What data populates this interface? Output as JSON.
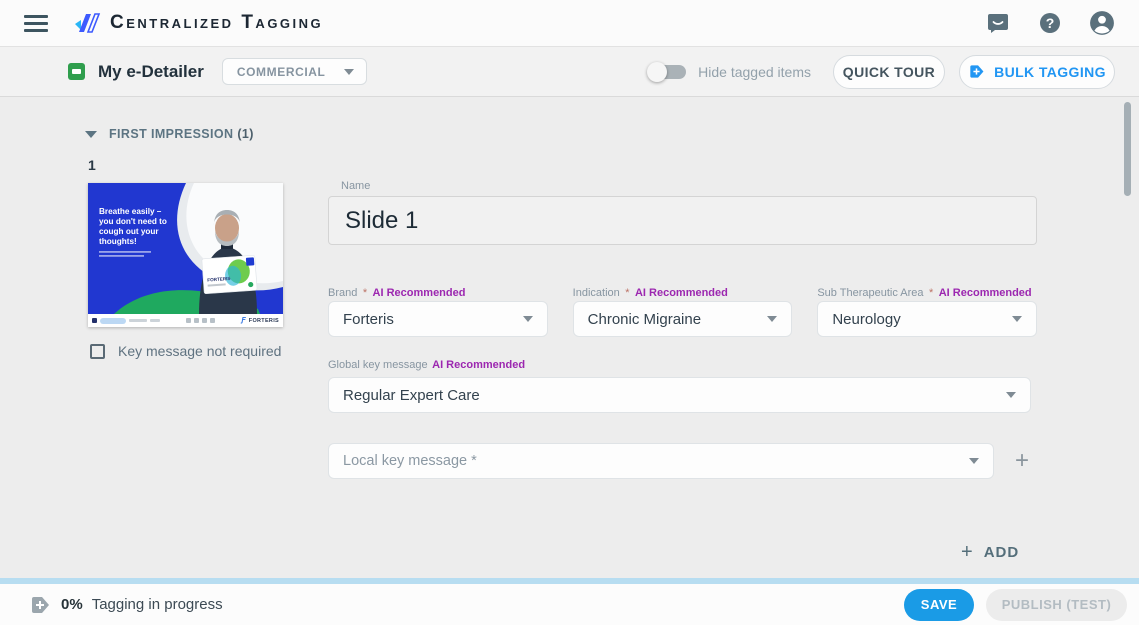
{
  "app_bar": {
    "title": "Centralized Tagging"
  },
  "toolbar": {
    "document_title": "My e-Detailer",
    "classification_value": "COMMERCIAL",
    "hide_tagged_label": "Hide tagged items",
    "quick_tour_label": "QUICK TOUR",
    "bulk_tagging_label": "BULK TAGGING"
  },
  "section": {
    "title": "FIRST IMPRESSION",
    "count": "(1)"
  },
  "slide": {
    "number": "1",
    "checkbox_label": "Key message not required",
    "thumbnail": {
      "headline_lines": [
        "Breathe easily –",
        "you don't need to",
        "cough out your",
        "thoughts!"
      ],
      "brand": "FORTERIS"
    }
  },
  "form": {
    "name": {
      "label": "Name",
      "value": "Slide 1"
    },
    "fields": [
      {
        "label": "Brand",
        "required": "*",
        "ai_tag": "AI Recommended",
        "value": "Forteris"
      },
      {
        "label": "Indication",
        "required": "*",
        "ai_tag": "AI Recommended",
        "value": "Chronic Migraine"
      },
      {
        "label": "Sub Therapeutic Area",
        "required": "*",
        "ai_tag": "AI Recommended",
        "value": "Neurology"
      }
    ],
    "global_key_message": {
      "label": "Global key message",
      "ai_tag": "AI Recommended",
      "value": "Regular Expert Care"
    },
    "local_key_message": {
      "placeholder": "Local key message *"
    },
    "add_button_label": "ADD"
  },
  "footer": {
    "progress_percent": "0%",
    "progress_text": "Tagging in progress",
    "save_label": "SAVE",
    "publish_label": "PUBLISH (TEST)"
  },
  "colors": {
    "accent_blue": "#1e9be6",
    "ai_purple": "#9c27b0",
    "brand_green": "#2f9e4d",
    "slide_blue": "#2137d0",
    "progress_track_blue": "#b7ddf1"
  }
}
